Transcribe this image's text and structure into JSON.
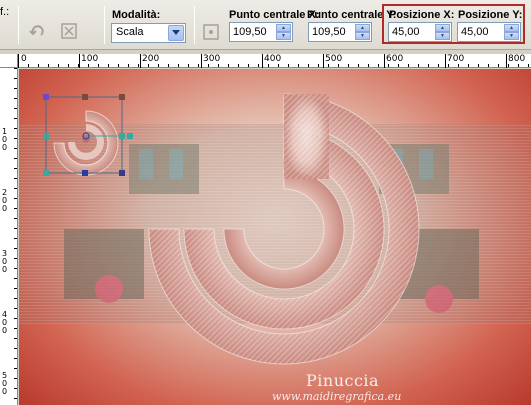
{
  "toolbar": {
    "truncated_label": "f.:",
    "mode": {
      "label": "Modalità:",
      "value": "Scala"
    },
    "center_x": {
      "label": "Punto centrale X:",
      "value": "109,50"
    },
    "center_y": {
      "label": "Punto centrale Y:",
      "value": "109,50"
    },
    "pos_x": {
      "label": "Posizione X:",
      "value": "45,00"
    },
    "pos_y": {
      "label": "Posizione Y:",
      "value": "45,00"
    }
  },
  "ruler": {
    "top_labels": [
      "0",
      "100",
      "200",
      "300",
      "400",
      "500",
      "600",
      "700",
      "800"
    ],
    "left_labels": [
      "1\n0\n0",
      "2\n0\n0",
      "3\n0\n0",
      "4\n0\n0",
      "5\n0\n0"
    ]
  },
  "canvas": {
    "watermark_name": "Pinuccia",
    "watermark_url": "www.maidiregrafica.eu"
  },
  "icons": {
    "rotate": "rotate-arrow-icon",
    "reset": "reset-icon",
    "center": "center-point-icon"
  },
  "colors": {
    "highlight": "#b02a2a",
    "accent_blue": "#7f9db9",
    "canvas_red": "#c9463a"
  }
}
